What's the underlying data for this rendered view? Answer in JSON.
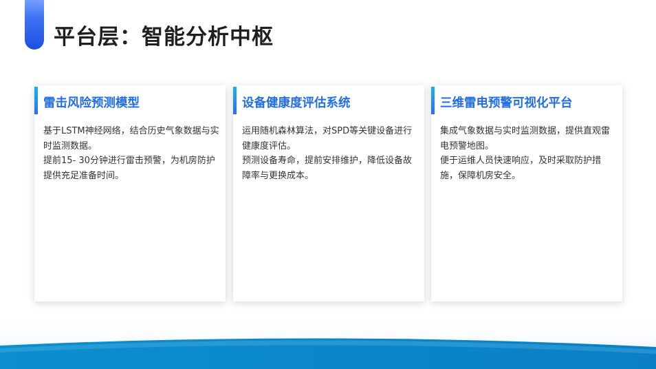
{
  "header": {
    "title": "平台层：智能分析中枢"
  },
  "cards": [
    {
      "title": "雷击风险预测模型",
      "lines": [
        "基于LSTM神经网络，结合历史气象数据与实时监测数据。",
        "提前15- 30分钟进行雷击预警，为机房防护提供充足准备时间。"
      ]
    },
    {
      "title": "设备健康度评估系统",
      "lines": [
        "运用随机森林算法，对SPD等关键设备进行健康度评估。",
        "预测设备寿命，提前安排维护，降低设备故障率与更换成本。"
      ]
    },
    {
      "title": "三维雷电预警可视化平台",
      "lines": [
        "集成气象数据与实时监测数据，提供直观雷电预警地图。",
        "便于运维人员快速响应，及时采取防护措施，保障机房安全。"
      ]
    }
  ],
  "colors": {
    "accent": "#1f6ee8",
    "title_text": "#1f1f1f",
    "body_text": "#333333",
    "wave_deep": "#0a8fd0",
    "wave_light": "#dceaf8"
  }
}
